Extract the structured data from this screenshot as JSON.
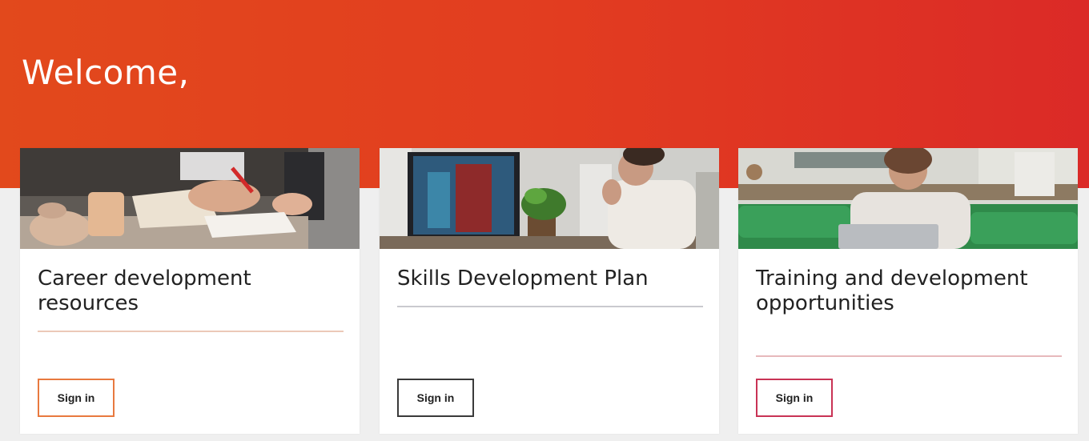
{
  "header": {
    "welcome": "Welcome,",
    "gradient_start": "#e2491c",
    "gradient_end": "#db2a27"
  },
  "cards": [
    {
      "title": "Career development resources",
      "button_label": "Sign in",
      "accent": "#e8793f",
      "image": "photo-workspace-pottery-notebook"
    },
    {
      "title": "Skills Development Plan",
      "button_label": "Sign in",
      "accent": "#3a3a3a",
      "image": "photo-woman-at-monitor"
    },
    {
      "title": "Training and development opportunities",
      "button_label": "Sign in",
      "accent": "#c93355",
      "image": "photo-woman-laptop-sofa"
    }
  ]
}
